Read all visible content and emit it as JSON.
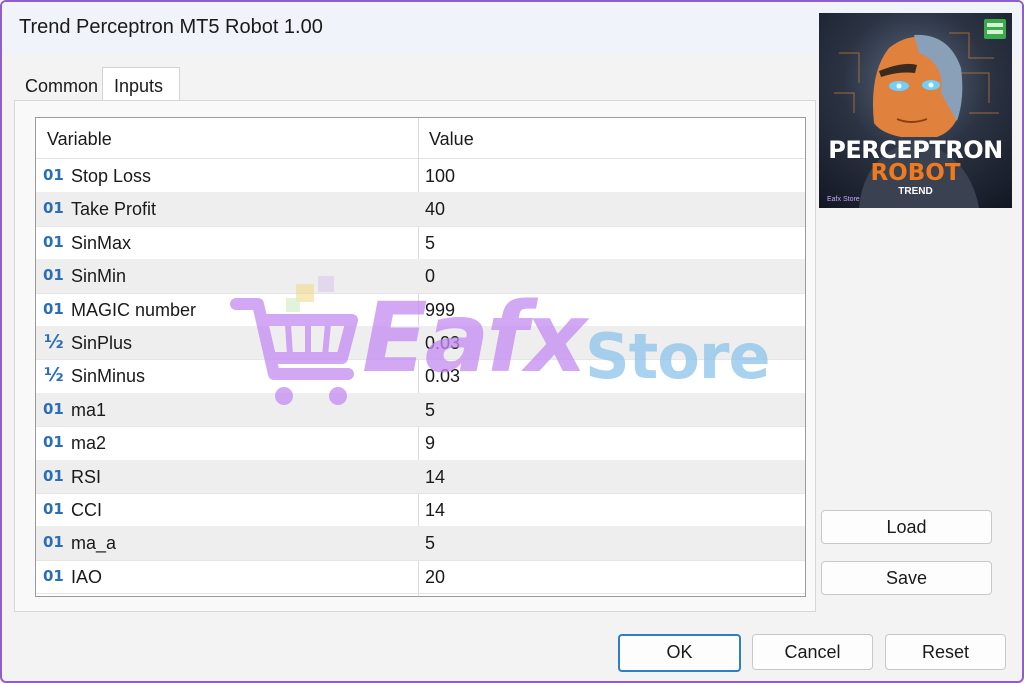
{
  "window": {
    "title": "Trend Perceptron MT5 Robot 1.00"
  },
  "tabs": [
    {
      "label": "Common"
    },
    {
      "label": "Inputs"
    }
  ],
  "grid": {
    "headers": {
      "variable": "Variable",
      "value": "Value"
    },
    "rows": [
      {
        "icon": "01",
        "variable": "Stop Loss",
        "value": "100"
      },
      {
        "icon": "01",
        "variable": "Take Profit",
        "value": "40"
      },
      {
        "icon": "01",
        "variable": "SinMax",
        "value": "5"
      },
      {
        "icon": "01",
        "variable": "SinMin",
        "value": "0"
      },
      {
        "icon": "01",
        "variable": "MAGIC number",
        "value": "999"
      },
      {
        "icon": "½",
        "variable": "SinPlus",
        "value": "0.03"
      },
      {
        "icon": "½",
        "variable": "SinMinus",
        "value": "0.03"
      },
      {
        "icon": "01",
        "variable": "ma1",
        "value": "5"
      },
      {
        "icon": "01",
        "variable": "ma2",
        "value": "9"
      },
      {
        "icon": "01",
        "variable": "RSI",
        "value": "14"
      },
      {
        "icon": "01",
        "variable": "CCI",
        "value": "14"
      },
      {
        "icon": "01",
        "variable": "ma_a",
        "value": "5"
      },
      {
        "icon": "01",
        "variable": "IAO",
        "value": "20"
      }
    ]
  },
  "side_buttons": {
    "load": "Load",
    "save": "Save"
  },
  "footer_buttons": {
    "ok": "OK",
    "cancel": "Cancel",
    "reset": "Reset"
  },
  "logo": {
    "line1": "PERCEPTRON",
    "line2": "ROBOT",
    "line3": "TREND",
    "brand": "Eafx Store"
  },
  "watermark": {
    "word1": "Eafx",
    "word2": "Store"
  },
  "colors": {
    "int_icon": "#2a6fb5",
    "accent_border": "#8e5fc9",
    "ok_border": "#2f7ec7",
    "logo_orange": "#f07a1c"
  }
}
